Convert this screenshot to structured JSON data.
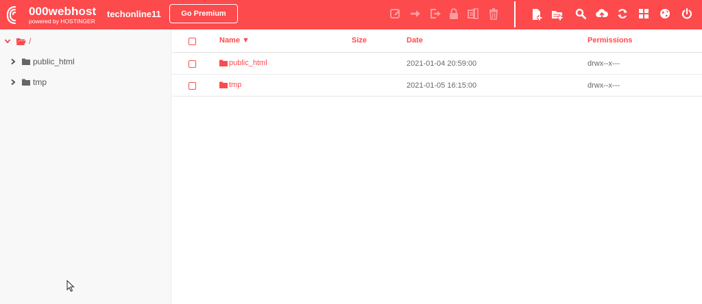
{
  "brand": {
    "name": "000webhost",
    "tagline": "powered by HOSTINGER"
  },
  "header": {
    "username": "techonline11",
    "premium_label": "Go Premium"
  },
  "toolbar": {
    "disabled_icons": [
      "edit-icon",
      "move-icon",
      "export-icon",
      "lock-icon",
      "archive-icon",
      "trash-icon"
    ],
    "enabled_icons": [
      "new-file-icon",
      "new-folder-icon",
      "search-icon",
      "upload-icon",
      "refresh-icon",
      "grid-view-icon",
      "globe-icon",
      "power-icon"
    ]
  },
  "sidebar": {
    "root_label": "/",
    "items": [
      {
        "label": "public_html"
      },
      {
        "label": "tmp"
      }
    ]
  },
  "table": {
    "columns": {
      "name": "Name ▼",
      "size": "Size",
      "date": "Date",
      "permissions": "Permissions"
    },
    "rows": [
      {
        "name": "public_html",
        "size": "",
        "date": "2021-01-04 20:59:00",
        "permissions": "drwx--x---"
      },
      {
        "name": "tmp",
        "size": "",
        "date": "2021-01-05 16:15:00",
        "permissions": "drwx--x---"
      }
    ]
  },
  "colors": {
    "accent": "#fc4a4d",
    "disabled_icon": "#fd9c9d",
    "sidebar_bg": "#f8f8f8"
  }
}
